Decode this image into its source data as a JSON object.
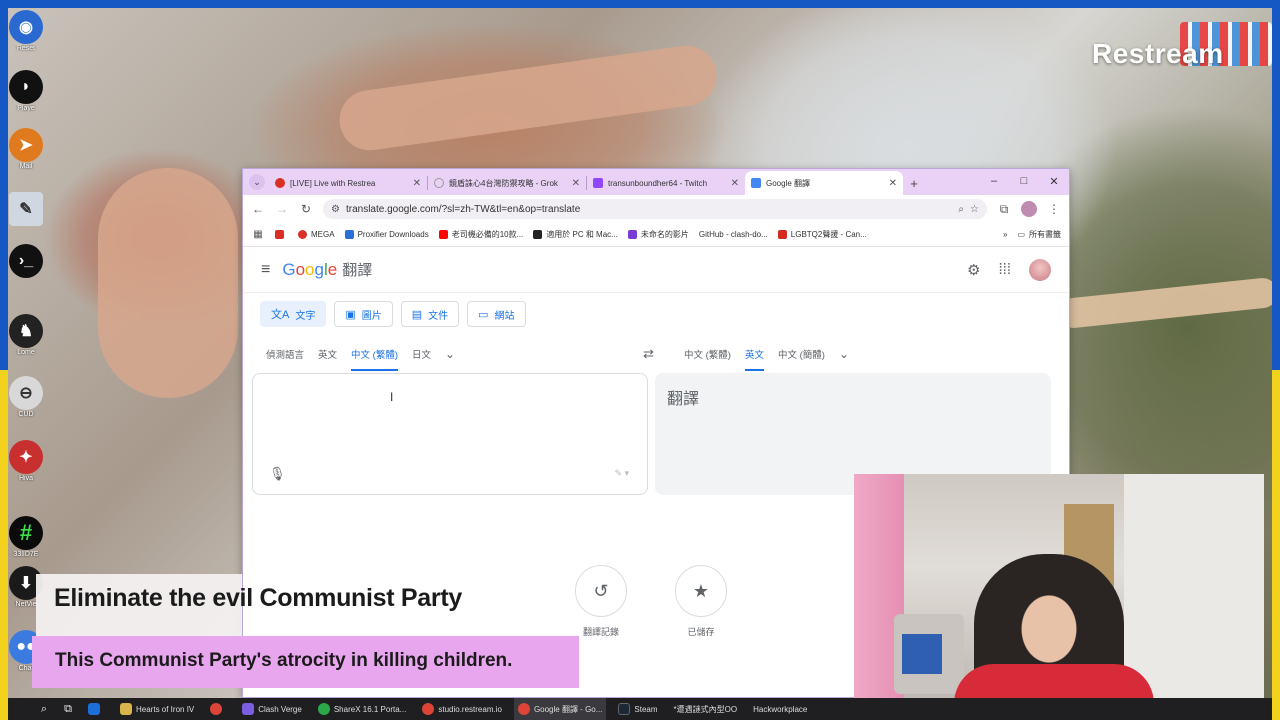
{
  "overlay": {
    "brand": "Restream",
    "caption_title": "Eliminate the evil Communist Party",
    "caption_sub": "This  Communist Party's atrocity in killing children."
  },
  "desktop_icons": [
    {
      "label": "Reset",
      "icon": "globe-icon",
      "color": "#2a6ad0"
    },
    {
      "label": "Playe",
      "icon": "helmet-icon",
      "color": "#111111"
    },
    {
      "label": "Mail",
      "icon": "paper-plane-icon",
      "color": "#e07a1f"
    },
    {
      "label": "",
      "icon": "notepad-icon",
      "color": "#cfd8e0"
    },
    {
      "label": "",
      "icon": "terminal-icon",
      "color": "#111111"
    },
    {
      "label": "Lome",
      "icon": "penguin-icon",
      "color": "#222222"
    },
    {
      "label": "CUD",
      "icon": "drive-icon",
      "color": "#d8d8d8"
    },
    {
      "label": "Hiva",
      "icon": "compass-icon",
      "color": "#c83030"
    },
    {
      "label": "33lID7E",
      "icon": "hash-icon",
      "color": "#0b0b0b"
    },
    {
      "label": "NetVie",
      "icon": "download-icon",
      "color": "#1a1a1a"
    },
    {
      "label": "Chat",
      "icon": "chat-icon",
      "color": "#3b7be0"
    }
  ],
  "browser": {
    "tabs": [
      {
        "title": "[LIVE] Live with Restrea",
        "color": "#d93025",
        "active": false
      },
      {
        "title": "鏡盾誅心4台灣防禦攻略 - Grok",
        "color": "#6b6b6b",
        "active": false
      },
      {
        "title": "transunboundher64 - Twitch",
        "color": "#9146ff",
        "active": false
      },
      {
        "title": "Google 翻譯",
        "color": "#4285f4",
        "active": true
      }
    ],
    "new_tab": "+",
    "window_controls": [
      "–",
      "□",
      "✕"
    ],
    "url": "translate.google.com/?sl=zh-TW&tl=en&op=translate",
    "bookmarks": [
      {
        "label": "",
        "color": "#d93025"
      },
      {
        "label": "MEGA",
        "color": "#d93025"
      },
      {
        "label": "Proxifier Downloads",
        "color": "#2b70d6"
      },
      {
        "label": "老司機必備的10款...",
        "color": "#ff0000"
      },
      {
        "label": "適用於 PC 和 Mac...",
        "color": "#222222"
      },
      {
        "label": "未命名的影片",
        "color": "#7a3bd6"
      },
      {
        "label": "GitHub - clash-do...",
        "color": "#ffffff"
      },
      {
        "label": "LGBTQ2聲援 - Can...",
        "color": "#d52b1e"
      }
    ],
    "bookmarks_more": "»",
    "bookmarks_folder": "所有書籤"
  },
  "translate": {
    "app_name": "翻譯",
    "logo": {
      "g": "G",
      "o1": "o",
      "o2": "o",
      "g2": "g",
      "l": "l",
      "e": "e"
    },
    "modes": [
      {
        "label": "文字",
        "icon": "translate-icon",
        "active": true
      },
      {
        "label": "圖片",
        "icon": "image-icon",
        "active": false
      },
      {
        "label": "文件",
        "icon": "document-icon",
        "active": false
      },
      {
        "label": "網站",
        "icon": "website-icon",
        "active": false
      }
    ],
    "source_langs": [
      "偵測語言",
      "英文",
      "中文 (繁體)",
      "日文"
    ],
    "source_selected": 2,
    "target_langs": [
      "中文 (繁體)",
      "英文",
      "中文 (簡體)"
    ],
    "target_selected": 1,
    "target_placeholder": "翻譯",
    "history_label": "翻譯記錄",
    "saved_label": "已儲存"
  },
  "taskbar": {
    "items": [
      {
        "label": "",
        "color": "#1b6fd6"
      },
      {
        "label": "Hearts of Iron IV",
        "color": "#d9b44a"
      },
      {
        "label": "",
        "color": "#db4437"
      },
      {
        "label": "Clash Verge",
        "color": "#7b5ee0"
      },
      {
        "label": "ShareX 16.1 Porta...",
        "color": "#2ba84a"
      },
      {
        "label": "studio.restream.io",
        "color": "#db4437"
      },
      {
        "label": "Google 翻譯 - Go...",
        "color": "#db4437"
      },
      {
        "label": "Steam",
        "color": "#1b2838"
      },
      {
        "label": "*遭遇謎式內型OO",
        "color": "#888888"
      },
      {
        "label": "Hackworkplace",
        "color": "#555555"
      }
    ]
  }
}
